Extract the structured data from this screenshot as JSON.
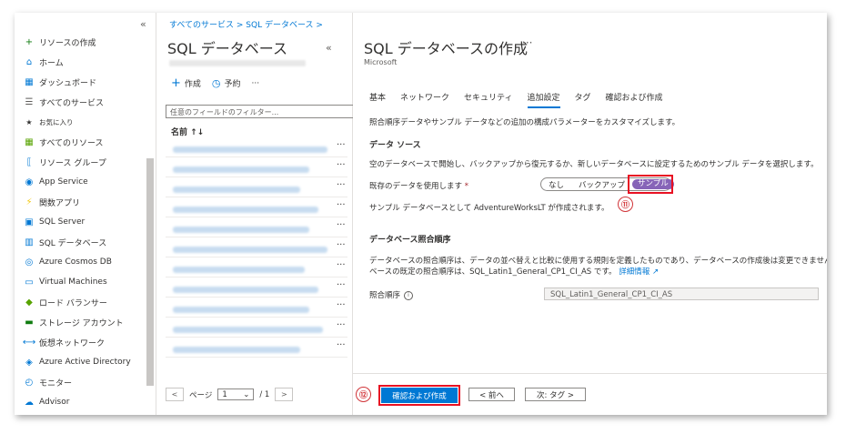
{
  "sidebar": {
    "collapse_icon": "«",
    "items": [
      {
        "label": "リソースの作成",
        "icon": "plus-icon",
        "color": "#107c10"
      },
      {
        "label": "ホーム",
        "icon": "home-icon",
        "color": "#0078d4"
      },
      {
        "label": "ダッシュボード",
        "icon": "dashboard-icon",
        "color": "#0078d4"
      },
      {
        "label": "すべてのサービス",
        "icon": "list-icon",
        "color": "#605e5c"
      },
      {
        "label": "お気に入り",
        "icon": "star-icon",
        "color": "#323130"
      },
      {
        "label": "すべてのリソース",
        "icon": "grid-icon",
        "color": "#57a300"
      },
      {
        "label": "リソース グループ",
        "icon": "resource-group-icon",
        "color": "#0078d4"
      },
      {
        "label": "App Service",
        "icon": "app-service-icon",
        "color": "#0078d4"
      },
      {
        "label": "関数アプリ",
        "icon": "function-icon",
        "color": "#f2c811"
      },
      {
        "label": "SQL Server",
        "icon": "sql-server-icon",
        "color": "#0078d4"
      },
      {
        "label": "SQL データベース",
        "icon": "sql-database-icon",
        "color": "#0078d4"
      },
      {
        "label": "Azure Cosmos DB",
        "icon": "cosmos-icon",
        "color": "#0078d4"
      },
      {
        "label": "Virtual Machines",
        "icon": "vm-icon",
        "color": "#0078d4"
      },
      {
        "label": "ロード バランサー",
        "icon": "load-balancer-icon",
        "color": "#57a300"
      },
      {
        "label": "ストレージ アカウント",
        "icon": "storage-icon",
        "color": "#107c10"
      },
      {
        "label": "仮想ネットワーク",
        "icon": "vnet-icon",
        "color": "#0078d4"
      },
      {
        "label": "Azure Active Directory",
        "icon": "aad-icon",
        "color": "#0078d4"
      },
      {
        "label": "モニター",
        "icon": "monitor-icon",
        "color": "#0078d4"
      },
      {
        "label": "Advisor",
        "icon": "advisor-icon",
        "color": "#0078d4"
      }
    ]
  },
  "listpanel": {
    "breadcrumb": "すべてのサービス > SQL データベース >",
    "title": "SQL データベース",
    "collapse_icon": "«",
    "toolbar": {
      "create": "作成",
      "reserve": "予約",
      "more": "···"
    },
    "filter_placeholder": "任意のフィールドのフィルター...",
    "column_name": "名前 ↑↓",
    "row_more": "···",
    "pager": {
      "page_label": "ページ",
      "page_value": "1",
      "total": "/ 1",
      "prev": "<",
      "next": ">"
    }
  },
  "blade": {
    "title": "SQL データベースの作成",
    "more": "···",
    "subtitle": "Microsoft",
    "tabs": [
      "基本",
      "ネットワーク",
      "セキュリティ",
      "追加設定",
      "タグ",
      "確認および作成"
    ],
    "active_tab": 3,
    "intro": "照合順序データやサンプル データなどの追加の構成パラメーターをカスタマイズします。",
    "data_source_heading": "データ ソース",
    "data_source_desc": "空のデータベースで開始し、バックアップから復元するか、新しいデータベースに設定するためのサンプル データを選択します。",
    "use_existing_label": "既存のデータを使用します",
    "required_mark": "*",
    "options": [
      "なし",
      "バックアップ",
      "サンプル"
    ],
    "selected_option": "サンプル",
    "sample_note": "サンプル データベースとして AdventureWorksLT が作成されます。",
    "collation_heading": "データベース照合順序",
    "collation_desc_1": "データベースの照合順序は、データの並べ替えと比較に使用する規則を定義したものであり、データベースの作成後は変更できません。データ",
    "collation_desc_2": "ベースの既定の照合順序は、SQL_Latin1_General_CP1_CI_AS です。",
    "learn_more": "詳細情報",
    "collation_label": "照合順序",
    "collation_value": "SQL_Latin1_General_CP1_CI_AS",
    "buttons": {
      "review_create": "確認および作成",
      "prev": "< 前へ",
      "next": "次: タグ >"
    }
  },
  "annotations": {
    "callout_11": "⑪",
    "callout_12": "⑫"
  },
  "colors": {
    "accent": "#0078d4",
    "highlight": "#e81123",
    "toggle_selected": "#8764b8"
  }
}
